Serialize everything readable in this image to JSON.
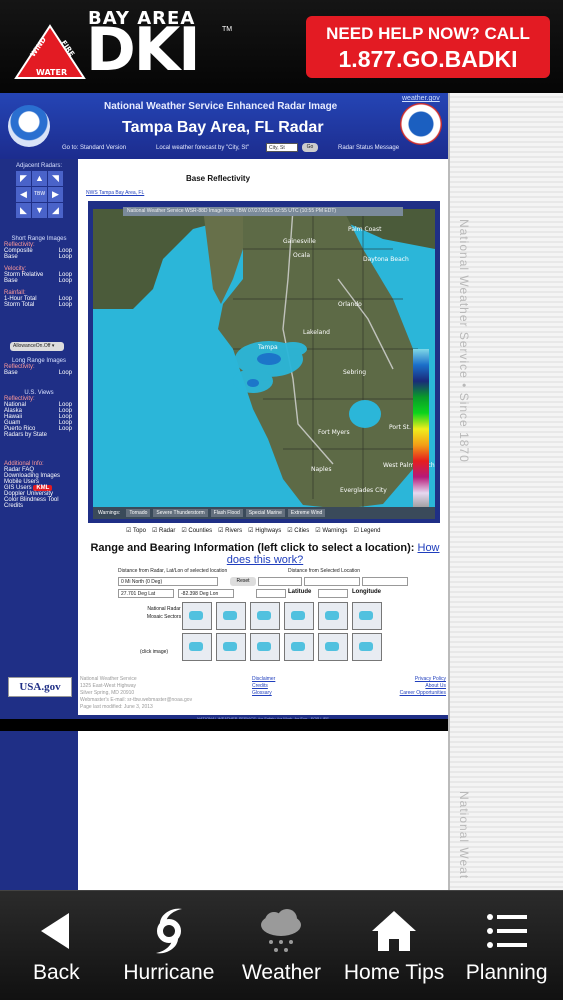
{
  "banner": {
    "logo_words": [
      "WIND",
      "FIRE",
      "WATER"
    ],
    "brand_top": "BAY AREA",
    "brand_main": "DKI",
    "trademark": "TM",
    "help_line1": "NEED HELP NOW? CALL",
    "help_line2": "1.877.GO.BADKI",
    "accent_color": "#e31b23"
  },
  "nws_page": {
    "weather_gov_link": "weather.gov",
    "subtitle": "National Weather Service Enhanced Radar Image",
    "title": "Tampa Bay Area, FL Radar",
    "goto": "Go to: Standard Version",
    "forecast_label": "Local weather forecast by \"City, St\"",
    "city_input_value": "City, St",
    "go_button": "Go",
    "radar_status": "Radar Status Message",
    "side_text": "National Weather Service • Since 1870",
    "side_text_2": "National Weat"
  },
  "left_nav": {
    "adjacent_radars": "Adjacent Radars:",
    "arrows": [
      "◤",
      "▲",
      "◥",
      "◀",
      "TBW",
      "▶",
      "◣",
      "▼",
      "◢"
    ],
    "short_range": "Short Range Images",
    "reflectivity": "Reflectivity:",
    "composite": "Composite",
    "base": "Base",
    "loop": "Loop",
    "velocity": "Velocity:",
    "storm_relative": "Storm Relative",
    "rainfall": "Rainfall:",
    "one_hour": "1-Hour Total",
    "storm_total": "Storm Total",
    "wms_select": "AllowanceOn.Off",
    "long_range": "Long Range Images",
    "us_views": "U.S. Views",
    "national": "National",
    "alaska": "Alaska",
    "hawaii": "Hawaii",
    "guam": "Guam",
    "puerto_rico": "Puerto Rico",
    "radars_by_state": "Radars by State",
    "additional_info": "Additional Info:",
    "radar_faq": "Radar FAQ",
    "downloading_images": "Downloading Images",
    "mobile_users": "Mobile Users",
    "gis_users": "GIS Users",
    "kml": "KML",
    "doppler_university": "Doppler University",
    "color_blindness": "Color Blindness Tool",
    "credits": "Credits"
  },
  "main": {
    "base_reflectivity": "Base Reflectivity",
    "nws_tampa_link": "NWS Tampa Bay Area, FL",
    "map_title": "National Weather Service WSR-88D Image from TBW 07/27/2015 02:55 UTC (10:55 PM EDT)",
    "warnings_label": "Warnings:",
    "warning_buttons": [
      "Tornado",
      "Severe Thunderstorm",
      "Flash Flood",
      "Special Marine",
      "Extreme Wind"
    ],
    "layer_checks": [
      "Topo",
      "Radar",
      "Counties",
      "Rivers",
      "Highways",
      "Cities",
      "Warnings",
      "Legend"
    ],
    "rb_title": "Range and Bearing Information (left click to select a location):",
    "rb_link": "How does this work?",
    "dist_from_radar": "Distance from Radar, Lat/Lon of selected location",
    "dist_from_selected": "Distance from Selected Location",
    "field_dist": "0 Mi North (0 Deg)",
    "reset": "Reset",
    "field_lat": "27.701 Deg Lat",
    "field_lon": "-82.398 Deg Lon",
    "latitude": "Latitude",
    "longitude": "Longitude",
    "mosaic_label": "National Radar Mosaic Sectors",
    "click_image": "(click image)",
    "footer_left": [
      "National Weather Service",
      "1325 East-West Highway",
      "Silver Spring, MD 20910",
      "Webmaster's E-mail: sr-tbw.webmaster@noaa.gov",
      "Page last modified: June 3, 2013"
    ],
    "footer_mid": [
      "Disclaimer",
      "Credits",
      "Glossary"
    ],
    "footer_right": [
      "Privacy Policy",
      "About Us",
      "Career Opportunities"
    ],
    "footer_bar": "NATIONAL WEATHER SERVICE: for Safety, for Work, for Fun - FOR LIFE",
    "usagov": "USA.gov"
  },
  "map_labels": [
    "Gainesville",
    "Ocala",
    "Daytona Beach",
    "Palm Coast",
    "Orlando",
    "Lakeland",
    "Sebring",
    "Fort Myers",
    "Naples",
    "Everglades City",
    "Tampa",
    "Port St. Lucie",
    "West Palm Beach"
  ],
  "tabbar": {
    "items": [
      {
        "label": "Back",
        "icon": "back-arrow-icon"
      },
      {
        "label": "Hurricane",
        "icon": "hurricane-icon"
      },
      {
        "label": "Weather",
        "icon": "rain-cloud-icon"
      },
      {
        "label": "Home Tips",
        "icon": "home-icon"
      },
      {
        "label": "Planning",
        "icon": "list-icon"
      }
    ]
  }
}
